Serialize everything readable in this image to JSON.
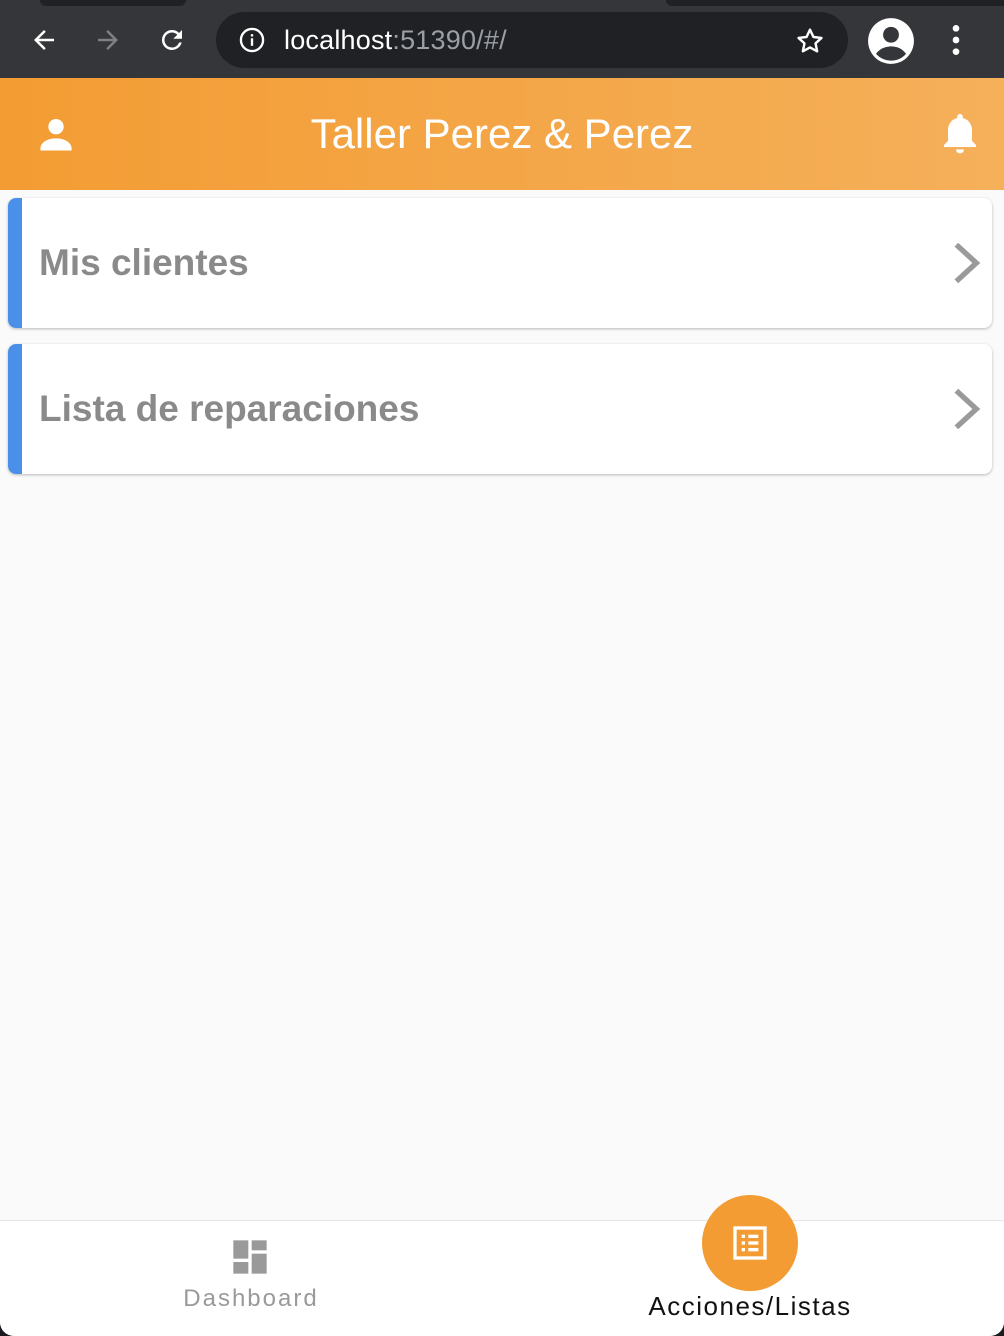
{
  "browser": {
    "url_host": "localhost",
    "url_rest": ":51390/#/",
    "icons": {
      "back": "back-arrow-icon",
      "forward": "forward-arrow-icon",
      "reload": "reload-icon",
      "info": "info-icon",
      "bookmark": "star-icon",
      "profile": "account-circle-icon",
      "menu": "more-vert-icon"
    }
  },
  "header": {
    "title": "Taller Perez & Perez",
    "left_icon": "person-icon",
    "right_icon": "bell-icon",
    "color": "#f39c33"
  },
  "list": {
    "items": [
      {
        "label": "Mis clientes"
      },
      {
        "label": "Lista de reparaciones"
      }
    ],
    "accent_color": "#4a90e8"
  },
  "bottom_nav": {
    "items": [
      {
        "label": "Dashboard",
        "icon": "dashboard-icon",
        "active": false
      },
      {
        "label": "Acciones/Listas",
        "icon": "list-alt-icon",
        "active": true
      }
    ],
    "active_color": "#f39c33"
  }
}
